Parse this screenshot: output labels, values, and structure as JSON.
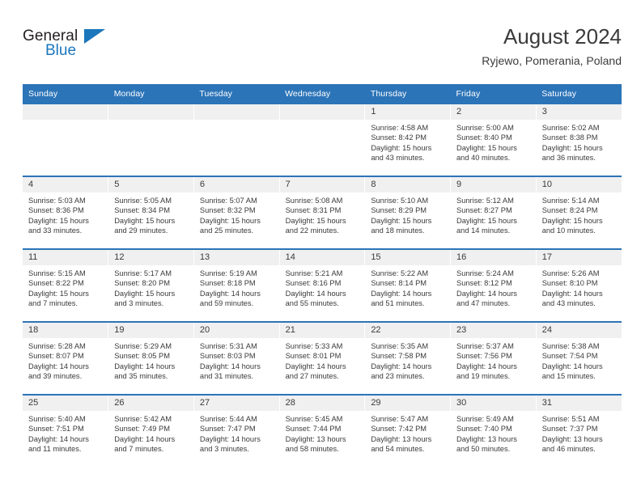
{
  "brand": {
    "name_part1": "General",
    "name_part2": "Blue",
    "accent_color": "#1b76bc"
  },
  "header": {
    "title": "August 2024",
    "location": "Ryjewo, Pomerania, Poland"
  },
  "theme": {
    "header_bg": "#2c74b8",
    "daynum_bg": "#f0f0f0",
    "text": "#3a3a3a"
  },
  "weekday_headers": [
    "Sunday",
    "Monday",
    "Tuesday",
    "Wednesday",
    "Thursday",
    "Friday",
    "Saturday"
  ],
  "weeks": [
    [
      {
        "day": "",
        "empty": true,
        "sunrise": "",
        "sunset": "",
        "daylight_line1": "",
        "daylight_line2": ""
      },
      {
        "day": "",
        "empty": true,
        "sunrise": "",
        "sunset": "",
        "daylight_line1": "",
        "daylight_line2": ""
      },
      {
        "day": "",
        "empty": true,
        "sunrise": "",
        "sunset": "",
        "daylight_line1": "",
        "daylight_line2": ""
      },
      {
        "day": "",
        "empty": true,
        "sunrise": "",
        "sunset": "",
        "daylight_line1": "",
        "daylight_line2": ""
      },
      {
        "day": "1",
        "empty": false,
        "sunrise": "Sunrise: 4:58 AM",
        "sunset": "Sunset: 8:42 PM",
        "daylight_line1": "Daylight: 15 hours",
        "daylight_line2": "and 43 minutes."
      },
      {
        "day": "2",
        "empty": false,
        "sunrise": "Sunrise: 5:00 AM",
        "sunset": "Sunset: 8:40 PM",
        "daylight_line1": "Daylight: 15 hours",
        "daylight_line2": "and 40 minutes."
      },
      {
        "day": "3",
        "empty": false,
        "sunrise": "Sunrise: 5:02 AM",
        "sunset": "Sunset: 8:38 PM",
        "daylight_line1": "Daylight: 15 hours",
        "daylight_line2": "and 36 minutes."
      }
    ],
    [
      {
        "day": "4",
        "empty": false,
        "sunrise": "Sunrise: 5:03 AM",
        "sunset": "Sunset: 8:36 PM",
        "daylight_line1": "Daylight: 15 hours",
        "daylight_line2": "and 33 minutes."
      },
      {
        "day": "5",
        "empty": false,
        "sunrise": "Sunrise: 5:05 AM",
        "sunset": "Sunset: 8:34 PM",
        "daylight_line1": "Daylight: 15 hours",
        "daylight_line2": "and 29 minutes."
      },
      {
        "day": "6",
        "empty": false,
        "sunrise": "Sunrise: 5:07 AM",
        "sunset": "Sunset: 8:32 PM",
        "daylight_line1": "Daylight: 15 hours",
        "daylight_line2": "and 25 minutes."
      },
      {
        "day": "7",
        "empty": false,
        "sunrise": "Sunrise: 5:08 AM",
        "sunset": "Sunset: 8:31 PM",
        "daylight_line1": "Daylight: 15 hours",
        "daylight_line2": "and 22 minutes."
      },
      {
        "day": "8",
        "empty": false,
        "sunrise": "Sunrise: 5:10 AM",
        "sunset": "Sunset: 8:29 PM",
        "daylight_line1": "Daylight: 15 hours",
        "daylight_line2": "and 18 minutes."
      },
      {
        "day": "9",
        "empty": false,
        "sunrise": "Sunrise: 5:12 AM",
        "sunset": "Sunset: 8:27 PM",
        "daylight_line1": "Daylight: 15 hours",
        "daylight_line2": "and 14 minutes."
      },
      {
        "day": "10",
        "empty": false,
        "sunrise": "Sunrise: 5:14 AM",
        "sunset": "Sunset: 8:24 PM",
        "daylight_line1": "Daylight: 15 hours",
        "daylight_line2": "and 10 minutes."
      }
    ],
    [
      {
        "day": "11",
        "empty": false,
        "sunrise": "Sunrise: 5:15 AM",
        "sunset": "Sunset: 8:22 PM",
        "daylight_line1": "Daylight: 15 hours",
        "daylight_line2": "and 7 minutes."
      },
      {
        "day": "12",
        "empty": false,
        "sunrise": "Sunrise: 5:17 AM",
        "sunset": "Sunset: 8:20 PM",
        "daylight_line1": "Daylight: 15 hours",
        "daylight_line2": "and 3 minutes."
      },
      {
        "day": "13",
        "empty": false,
        "sunrise": "Sunrise: 5:19 AM",
        "sunset": "Sunset: 8:18 PM",
        "daylight_line1": "Daylight: 14 hours",
        "daylight_line2": "and 59 minutes."
      },
      {
        "day": "14",
        "empty": false,
        "sunrise": "Sunrise: 5:21 AM",
        "sunset": "Sunset: 8:16 PM",
        "daylight_line1": "Daylight: 14 hours",
        "daylight_line2": "and 55 minutes."
      },
      {
        "day": "15",
        "empty": false,
        "sunrise": "Sunrise: 5:22 AM",
        "sunset": "Sunset: 8:14 PM",
        "daylight_line1": "Daylight: 14 hours",
        "daylight_line2": "and 51 minutes."
      },
      {
        "day": "16",
        "empty": false,
        "sunrise": "Sunrise: 5:24 AM",
        "sunset": "Sunset: 8:12 PM",
        "daylight_line1": "Daylight: 14 hours",
        "daylight_line2": "and 47 minutes."
      },
      {
        "day": "17",
        "empty": false,
        "sunrise": "Sunrise: 5:26 AM",
        "sunset": "Sunset: 8:10 PM",
        "daylight_line1": "Daylight: 14 hours",
        "daylight_line2": "and 43 minutes."
      }
    ],
    [
      {
        "day": "18",
        "empty": false,
        "sunrise": "Sunrise: 5:28 AM",
        "sunset": "Sunset: 8:07 PM",
        "daylight_line1": "Daylight: 14 hours",
        "daylight_line2": "and 39 minutes."
      },
      {
        "day": "19",
        "empty": false,
        "sunrise": "Sunrise: 5:29 AM",
        "sunset": "Sunset: 8:05 PM",
        "daylight_line1": "Daylight: 14 hours",
        "daylight_line2": "and 35 minutes."
      },
      {
        "day": "20",
        "empty": false,
        "sunrise": "Sunrise: 5:31 AM",
        "sunset": "Sunset: 8:03 PM",
        "daylight_line1": "Daylight: 14 hours",
        "daylight_line2": "and 31 minutes."
      },
      {
        "day": "21",
        "empty": false,
        "sunrise": "Sunrise: 5:33 AM",
        "sunset": "Sunset: 8:01 PM",
        "daylight_line1": "Daylight: 14 hours",
        "daylight_line2": "and 27 minutes."
      },
      {
        "day": "22",
        "empty": false,
        "sunrise": "Sunrise: 5:35 AM",
        "sunset": "Sunset: 7:58 PM",
        "daylight_line1": "Daylight: 14 hours",
        "daylight_line2": "and 23 minutes."
      },
      {
        "day": "23",
        "empty": false,
        "sunrise": "Sunrise: 5:37 AM",
        "sunset": "Sunset: 7:56 PM",
        "daylight_line1": "Daylight: 14 hours",
        "daylight_line2": "and 19 minutes."
      },
      {
        "day": "24",
        "empty": false,
        "sunrise": "Sunrise: 5:38 AM",
        "sunset": "Sunset: 7:54 PM",
        "daylight_line1": "Daylight: 14 hours",
        "daylight_line2": "and 15 minutes."
      }
    ],
    [
      {
        "day": "25",
        "empty": false,
        "sunrise": "Sunrise: 5:40 AM",
        "sunset": "Sunset: 7:51 PM",
        "daylight_line1": "Daylight: 14 hours",
        "daylight_line2": "and 11 minutes."
      },
      {
        "day": "26",
        "empty": false,
        "sunrise": "Sunrise: 5:42 AM",
        "sunset": "Sunset: 7:49 PM",
        "daylight_line1": "Daylight: 14 hours",
        "daylight_line2": "and 7 minutes."
      },
      {
        "day": "27",
        "empty": false,
        "sunrise": "Sunrise: 5:44 AM",
        "sunset": "Sunset: 7:47 PM",
        "daylight_line1": "Daylight: 14 hours",
        "daylight_line2": "and 3 minutes."
      },
      {
        "day": "28",
        "empty": false,
        "sunrise": "Sunrise: 5:45 AM",
        "sunset": "Sunset: 7:44 PM",
        "daylight_line1": "Daylight: 13 hours",
        "daylight_line2": "and 58 minutes."
      },
      {
        "day": "29",
        "empty": false,
        "sunrise": "Sunrise: 5:47 AM",
        "sunset": "Sunset: 7:42 PM",
        "daylight_line1": "Daylight: 13 hours",
        "daylight_line2": "and 54 minutes."
      },
      {
        "day": "30",
        "empty": false,
        "sunrise": "Sunrise: 5:49 AM",
        "sunset": "Sunset: 7:40 PM",
        "daylight_line1": "Daylight: 13 hours",
        "daylight_line2": "and 50 minutes."
      },
      {
        "day": "31",
        "empty": false,
        "sunrise": "Sunrise: 5:51 AM",
        "sunset": "Sunset: 7:37 PM",
        "daylight_line1": "Daylight: 13 hours",
        "daylight_line2": "and 46 minutes."
      }
    ]
  ]
}
